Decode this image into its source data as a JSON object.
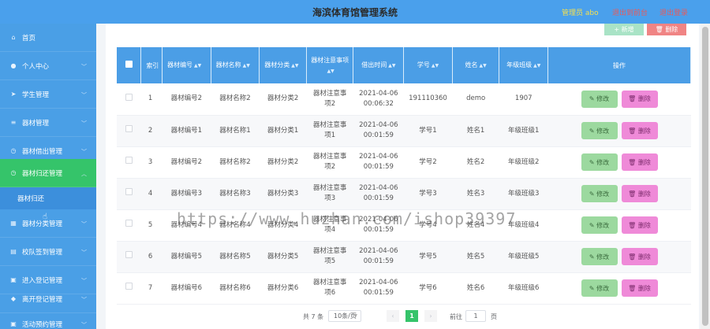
{
  "header": {
    "title": "海滨体育馆管理系统",
    "admin": "管理员 abo",
    "back_to_front": "退出到前台",
    "logout": "退出登录"
  },
  "sidebar": {
    "items": [
      {
        "label": "首页",
        "icon": "home-icon"
      },
      {
        "label": "个人中心",
        "icon": "user-icon"
      },
      {
        "label": "学生管理",
        "icon": "send-icon"
      },
      {
        "label": "器材管理",
        "icon": "list-icon"
      },
      {
        "label": "器材借出管理",
        "icon": "clock-icon"
      },
      {
        "label": "器材归还管理",
        "icon": "clock-icon"
      },
      {
        "label": "器材分类管理",
        "icon": "grid-icon"
      },
      {
        "label": "校队签到管理",
        "icon": "grid-icon"
      },
      {
        "label": "进入登记管理",
        "icon": "lock-icon"
      },
      {
        "label": "离开登记管理",
        "icon": "shield-icon"
      },
      {
        "label": "活动预约管理",
        "icon": "lock-icon"
      }
    ],
    "submenu_label": "器材归还"
  },
  "toolbar": {
    "add_label": "+ 新增",
    "delete_label": "删除"
  },
  "table": {
    "headers": {
      "index": "索引",
      "code": "器材编号",
      "name": "器材名称",
      "category": "器材分类",
      "notes": "器材注意事项",
      "borrow_time": "借出时间",
      "student_id": "学号",
      "student_name": "姓名",
      "grade": "年级班级",
      "actions": "操作"
    },
    "rows": [
      {
        "index": "1",
        "code": "器材编号2",
        "name": "器材名称2",
        "category": "器材分类2",
        "notes_a": "器材注意事",
        "notes_b": "项2",
        "date": "2021-04-06",
        "time": "00:06:32",
        "student_id": "191110360",
        "student_name": "demo",
        "grade": "1907"
      },
      {
        "index": "2",
        "code": "器材编号1",
        "name": "器材名称1",
        "category": "器材分类1",
        "notes_a": "器材注意事",
        "notes_b": "项1",
        "date": "2021-04-06",
        "time": "00:01:59",
        "student_id": "学号1",
        "student_name": "姓名1",
        "grade": "年级班级1"
      },
      {
        "index": "3",
        "code": "器材编号2",
        "name": "器材名称2",
        "category": "器材分类2",
        "notes_a": "器材注意事",
        "notes_b": "项2",
        "date": "2021-04-06",
        "time": "00:01:59",
        "student_id": "学号2",
        "student_name": "姓名2",
        "grade": "年级班级2"
      },
      {
        "index": "4",
        "code": "器材编号3",
        "name": "器材名称3",
        "category": "器材分类3",
        "notes_a": "器材注意事",
        "notes_b": "项3",
        "date": "2021-04-06",
        "time": "00:01:59",
        "student_id": "学号3",
        "student_name": "姓名3",
        "grade": "年级班级3"
      },
      {
        "index": "5",
        "code": "器材编号4",
        "name": "器材名称4",
        "category": "器材分类4",
        "notes_a": "器材注意事",
        "notes_b": "项4",
        "date": "2021-04-06",
        "time": "00:01:59",
        "student_id": "学号4",
        "student_name": "姓名4",
        "grade": "年级班级4"
      },
      {
        "index": "6",
        "code": "器材编号5",
        "name": "器材名称5",
        "category": "器材分类5",
        "notes_a": "器材注意事",
        "notes_b": "项5",
        "date": "2021-04-06",
        "time": "00:01:59",
        "student_id": "学号5",
        "student_name": "姓名5",
        "grade": "年级班级5"
      },
      {
        "index": "7",
        "code": "器材编号6",
        "name": "器材名称6",
        "category": "器材分类6",
        "notes_a": "器材注意事",
        "notes_b": "项6",
        "date": "2021-04-06",
        "time": "00:01:59",
        "student_id": "学号6",
        "student_name": "姓名6",
        "grade": "年级班级6"
      }
    ],
    "edit_label": "修改",
    "delete_label": "删除"
  },
  "pagination": {
    "total": "共 7 条",
    "page_size": "10条/页",
    "current_page": "1",
    "goto_label": "前往",
    "goto_value": "1",
    "unit": "页"
  },
  "watermark": "https://www.huzhan.com/ishop39397",
  "colors": {
    "header": "#4aa0ec",
    "sidebar": "#4a9fe6",
    "active": "#35c46a",
    "table_header": "#4b9ee6",
    "edit_button": "#9cd99f",
    "delete_button": "#ef8ad8"
  }
}
